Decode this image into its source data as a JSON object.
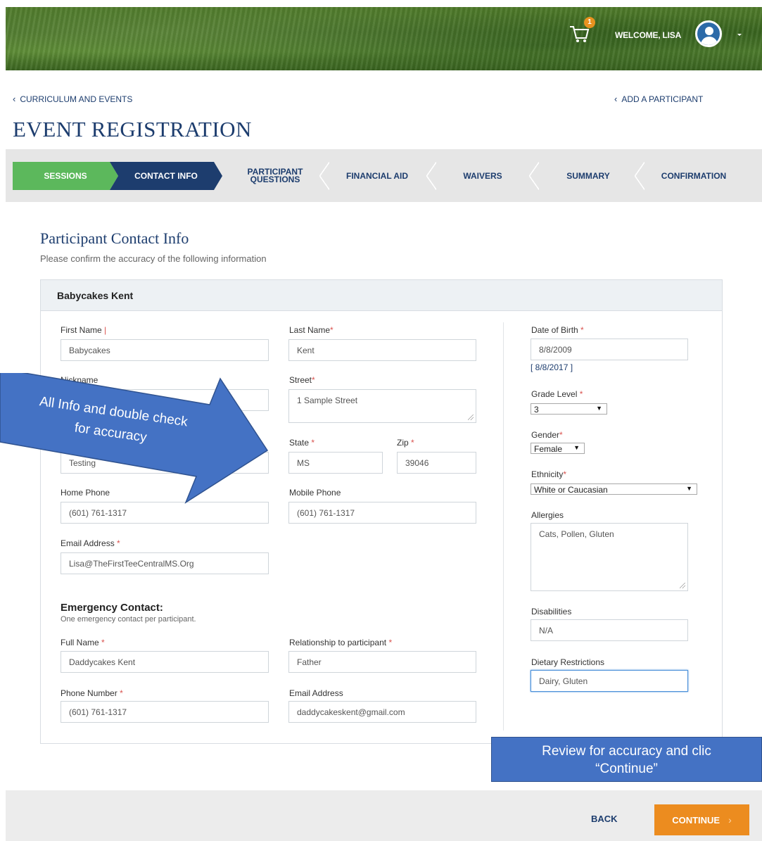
{
  "header": {
    "cart_count": "1",
    "welcome": "WELCOME, LISA"
  },
  "nav": {
    "back_left": "CURRICULUM AND EVENTS",
    "back_right": "ADD A PARTICIPANT"
  },
  "page_title": "EVENT REGISTRATION",
  "steps": {
    "sessions": "SESSIONS",
    "contact": "CONTACT INFO",
    "participant_questions_1": "PARTICIPANT",
    "participant_questions_2": "QUESTIONS",
    "financial_aid": "FINANCIAL AID",
    "waivers": "WAIVERS",
    "summary": "SUMMARY",
    "confirmation": "CONFIRMATION"
  },
  "section": {
    "title": "Participant Contact Info",
    "subtitle": "Please confirm the accuracy of the following information"
  },
  "participant_name": "Babycakes Kent",
  "fields": {
    "first_name": {
      "label": "First Name",
      "value": "Babycakes"
    },
    "last_name": {
      "label": "Last Name",
      "value": "Kent"
    },
    "nickname": {
      "label": "Nickname"
    },
    "street": {
      "label": "Street",
      "value": "1 Sample Street"
    },
    "state": {
      "label": "State",
      "value": "MS"
    },
    "zip": {
      "label": "Zip",
      "value": "39046"
    },
    "city": {
      "value": "Testing"
    },
    "home_phone": {
      "label": "Home Phone",
      "value": "(601) 761-1317"
    },
    "mobile_phone": {
      "label": "Mobile Phone",
      "value": "(601) 761-1317"
    },
    "email": {
      "label": "Email Address",
      "value": "Lisa@TheFirstTeeCentralMS.Org"
    },
    "dob": {
      "label": "Date of Birth",
      "value": "8/8/2009",
      "alt": "[ 8/8/2017 ]"
    },
    "grade": {
      "label": "Grade Level",
      "value": "3"
    },
    "gender": {
      "label": "Gender",
      "value": "Female"
    },
    "ethnicity": {
      "label": "Ethnicity",
      "value": "White or Caucasian"
    },
    "allergies": {
      "label": "Allergies",
      "value": "Cats, Pollen, Gluten"
    },
    "disabilities": {
      "label": "Disabilities",
      "value": "N/A"
    },
    "dietary": {
      "label": "Dietary Restrictions",
      "value": "Dairy, Gluten"
    }
  },
  "emergency": {
    "title": "Emergency Contact:",
    "subtitle": "One emergency contact per participant.",
    "full_name": {
      "label": "Full Name",
      "value": "Daddycakes Kent"
    },
    "relationship": {
      "label": "Relationship to participant",
      "value": "Father"
    },
    "phone": {
      "label": "Phone Number",
      "value": "(601) 761-1317"
    },
    "email": {
      "label": "Email Address",
      "value": "daddycakeskent@gmail.com"
    }
  },
  "footer": {
    "back": "BACK",
    "continue": "CONTINUE"
  },
  "annotations": {
    "arrow_line1": "All Info and double check",
    "arrow_line2": "for accuracy",
    "callout_line1": "Review for accuracy and clic",
    "callout_line2": "“Continue”"
  },
  "colors": {
    "brand_navy": "#1d3d6e",
    "step_green": "#5cb85c",
    "continue_orange": "#ec8c1f",
    "annotation_blue": "#4472c4",
    "required_red": "#d9534f"
  }
}
